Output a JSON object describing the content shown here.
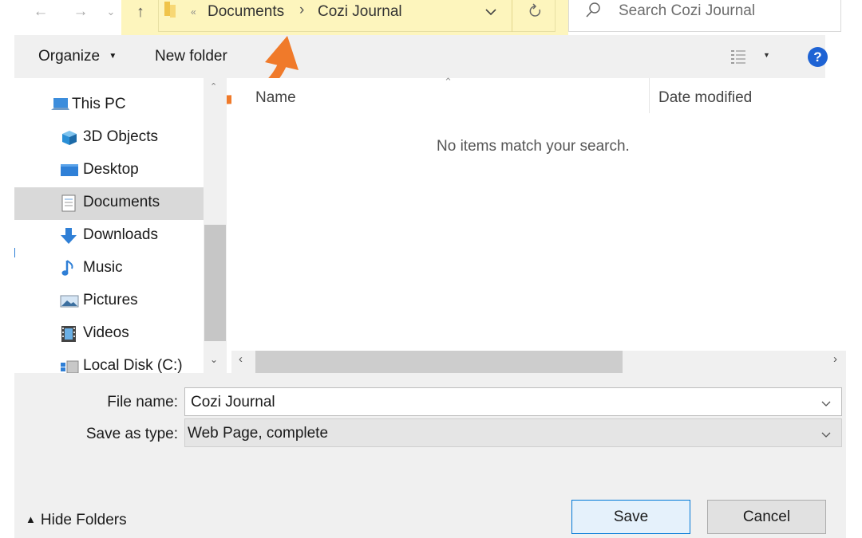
{
  "address": {
    "path": [
      "Documents",
      "Cozi Journal"
    ],
    "overflow_glyph": "«",
    "separator": "›"
  },
  "search": {
    "placeholder": "Search Cozi Journal"
  },
  "toolbar": {
    "organize_label": "Organize",
    "new_folder_label": "New folder"
  },
  "nav": {
    "items": [
      {
        "label": "This PC",
        "icon": "computer-icon"
      },
      {
        "label": "3D Objects",
        "icon": "3d-objects-icon"
      },
      {
        "label": "Desktop",
        "icon": "desktop-icon"
      },
      {
        "label": "Documents",
        "icon": "documents-icon",
        "selected": true
      },
      {
        "label": "Downloads",
        "icon": "download-arrow-icon"
      },
      {
        "label": "Music",
        "icon": "music-note-icon"
      },
      {
        "label": "Pictures",
        "icon": "pictures-icon"
      },
      {
        "label": "Videos",
        "icon": "videos-icon"
      },
      {
        "label": "Local Disk (C:)",
        "icon": "local-disk-icon"
      }
    ]
  },
  "content": {
    "columns": [
      "Name",
      "Date modified"
    ],
    "empty_message": "No items match your search."
  },
  "form": {
    "file_name_label": "File name:",
    "file_name_value": "Cozi Journal",
    "save_type_label": "Save as type:",
    "save_type_value": "Web Page, complete"
  },
  "footer": {
    "hide_folders_label": "Hide Folders",
    "save_label": "Save",
    "cancel_label": "Cancel"
  },
  "colors": {
    "highlight": "#fdf5bd",
    "annotation_arrow": "#f07a2a",
    "selected_item": "#d9d9d9",
    "save_border": "#0078d7",
    "help_icon": "#1e63d4"
  }
}
